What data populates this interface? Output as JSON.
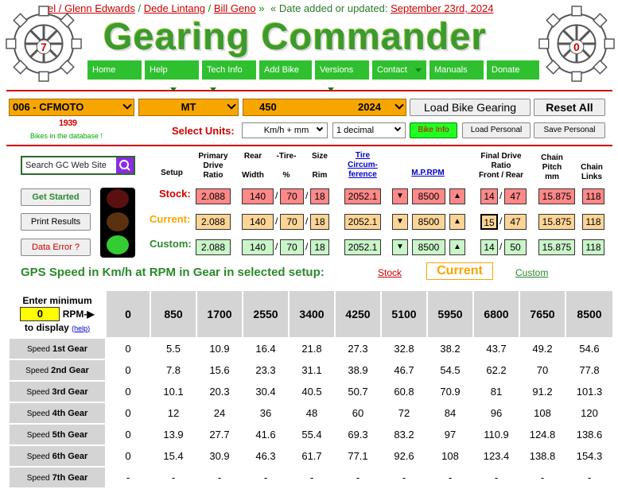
{
  "header": {
    "credits": [
      "el / Glenn Edwards",
      " / ",
      "Dede Lintang",
      " / ",
      "Bill Geno",
      " »"
    ],
    "date_prefix": "« Date added or updated: ",
    "date": "September 23rd, 2024",
    "title": "Gearing Commander",
    "left_gear_digit": "7",
    "right_gear_digit": "0"
  },
  "nav": [
    {
      "label": "Home",
      "caret": false
    },
    {
      "label": "Help",
      "caret": true
    },
    {
      "label": "Tech Info",
      "caret": true
    },
    {
      "label": "Add Bike",
      "caret": false
    },
    {
      "label": "Versions",
      "caret": true
    },
    {
      "label": "Contact",
      "caret": true
    },
    {
      "label": "Manuals",
      "caret": false
    },
    {
      "label": "Donate",
      "caret": false
    }
  ],
  "selectors": {
    "make": "006 - CFMOTO",
    "model": "MT",
    "size": "450",
    "year": "2024"
  },
  "buttons": {
    "load": "Load Bike Gearing",
    "reset": "Reset All",
    "bike_info": "Bike Info",
    "load_personal": "Load Personal",
    "save_personal": "Save Personal",
    "get_started": "Get Started",
    "print": "Print Results",
    "data_error": "Data Error ?"
  },
  "bike_count": "1939",
  "bikes_in_db": "Bikes in the database !",
  "units": {
    "label": "Select Units:",
    "speed": "Km/h + mm",
    "decimals": "1 decimal"
  },
  "search": {
    "placeholder": "Search GC Web Site"
  },
  "col_headers": {
    "setup": "Setup",
    "primary": [
      "Primary",
      "Drive",
      "Ratio"
    ],
    "rear": [
      "Rear",
      "Width"
    ],
    "tire": [
      "-Tire-",
      "%"
    ],
    "size": [
      "Size",
      "Rim"
    ],
    "circ": [
      "Tire",
      "Circum-",
      "ference"
    ],
    "mprpm": "M.P.RPM",
    "final": [
      "Final Drive",
      "Ratio",
      "Front / Rear"
    ],
    "chain_pitch": [
      "Chain",
      "Pitch",
      "mm"
    ],
    "chain_links": [
      "Chain",
      "Links"
    ]
  },
  "rows": {
    "stock": {
      "label": "Stock:",
      "primary": "2.088",
      "width": "140",
      "pct": "70",
      "rim": "18",
      "circ": "2052.1",
      "rpm": "8500",
      "front": "14",
      "rear": "47",
      "pitch": "15.875",
      "links": "118"
    },
    "current": {
      "label": "Current:",
      "primary": "2.088",
      "width": "140",
      "pct": "70",
      "rim": "18",
      "circ": "2052.1",
      "rpm": "8500",
      "front": "15",
      "rear": "47",
      "pitch": "15.875",
      "links": "118"
    },
    "custom": {
      "label": "Custom:",
      "primary": "2.088",
      "width": "140",
      "pct": "70",
      "rim": "18",
      "circ": "2052.1",
      "rpm": "8500",
      "front": "14",
      "rear": "50",
      "pitch": "15.875",
      "links": "118"
    }
  },
  "speed": {
    "heading": "GPS Speed in Km/h at RPM in Gear in selected setup:",
    "stock_link": "Stock",
    "current": "Current",
    "custom_link": "Custom",
    "enter_min": "Enter minimum",
    "min_value": "0",
    "rpm_label": "RPM-",
    "to_display": "to display",
    "help": "(help)",
    "rpms": [
      "0",
      "850",
      "1700",
      "2550",
      "3400",
      "4250",
      "5100",
      "5950",
      "6800",
      "7650",
      "8500"
    ],
    "gears": [
      {
        "label": "Speed",
        "gear": "1st Gear",
        "values": [
          "0",
          "5.5",
          "10.9",
          "16.4",
          "21.8",
          "27.3",
          "32.8",
          "38.2",
          "43.7",
          "49.2",
          "54.6"
        ]
      },
      {
        "label": "Speed",
        "gear": "2nd Gear",
        "values": [
          "0",
          "7.8",
          "15.6",
          "23.3",
          "31.1",
          "38.9",
          "46.7",
          "54.5",
          "62.2",
          "70",
          "77.8"
        ]
      },
      {
        "label": "Speed",
        "gear": "3rd Gear",
        "values": [
          "0",
          "10.1",
          "20.3",
          "30.4",
          "40.5",
          "50.7",
          "60.8",
          "70.9",
          "81",
          "91.2",
          "101.3"
        ]
      },
      {
        "label": "Speed",
        "gear": "4th Gear",
        "values": [
          "0",
          "12",
          "24",
          "36",
          "48",
          "60",
          "72",
          "84",
          "96",
          "108",
          "120"
        ]
      },
      {
        "label": "Speed",
        "gear": "5th Gear",
        "values": [
          "0",
          "13.9",
          "27.7",
          "41.6",
          "55.4",
          "69.3",
          "83.2",
          "97",
          "110.9",
          "124.8",
          "138.6"
        ]
      },
      {
        "label": "Speed",
        "gear": "6th Gear",
        "values": [
          "0",
          "15.4",
          "30.9",
          "46.3",
          "61.7",
          "77.1",
          "92.6",
          "108",
          "123.4",
          "138.8",
          "154.3"
        ]
      },
      {
        "label": "Speed",
        "gear": "7th Gear",
        "values": [
          "-",
          "-",
          "-",
          "-",
          "-",
          "-",
          "-",
          "-",
          "-",
          "-",
          "-"
        ]
      }
    ]
  }
}
